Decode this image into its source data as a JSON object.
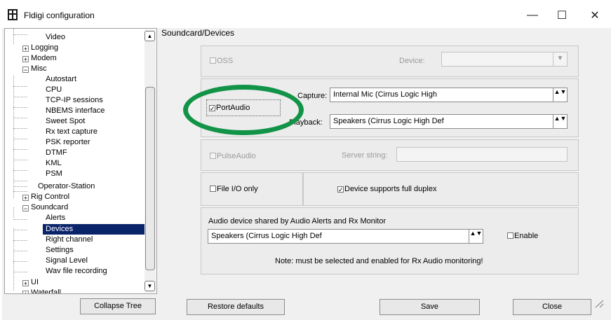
{
  "window": {
    "title": "Fldigi configuration",
    "minimize_glyph": "—",
    "maximize_glyph": "☐",
    "close_glyph": "✕"
  },
  "section_title": "Soundcard/Devices",
  "tree": {
    "items": [
      {
        "label": "Video",
        "level": 1
      },
      {
        "label": "Logging",
        "level": 0,
        "toggle": "+"
      },
      {
        "label": "Modem",
        "level": 0,
        "toggle": "+"
      },
      {
        "label": "Misc",
        "level": 0,
        "toggle": "−"
      },
      {
        "label": "Autostart",
        "level": 1
      },
      {
        "label": "CPU",
        "level": 1
      },
      {
        "label": "TCP-IP sessions",
        "level": 1
      },
      {
        "label": "NBEMS interface",
        "level": 1
      },
      {
        "label": "Sweet Spot",
        "level": 1
      },
      {
        "label": "Rx text capture",
        "level": 1
      },
      {
        "label": "PSK reporter",
        "level": 1
      },
      {
        "label": "DTMF",
        "level": 1
      },
      {
        "label": "KML",
        "level": 1
      },
      {
        "label": "PSM",
        "level": 1
      },
      {
        "label": "Operator-Station",
        "level": 0
      },
      {
        "label": "Rig Control",
        "level": 0,
        "toggle": "+"
      },
      {
        "label": "Soundcard",
        "level": 0,
        "toggle": "−"
      },
      {
        "label": "Alerts",
        "level": 1
      },
      {
        "label": "Devices",
        "level": 1,
        "selected": true
      },
      {
        "label": "Right channel",
        "level": 1
      },
      {
        "label": "Settings",
        "level": 1
      },
      {
        "label": "Signal Level",
        "level": 1
      },
      {
        "label": "Wav file recording",
        "level": 1
      },
      {
        "label": "UI",
        "level": 0,
        "toggle": "+"
      },
      {
        "label": "Waterfall",
        "level": 0,
        "toggle": "+"
      }
    ],
    "scroll_up_glyph": "▲",
    "scroll_down_glyph": "▼"
  },
  "oss": {
    "label": "OSS",
    "checked": false,
    "device_label": "Device:",
    "device_value": ""
  },
  "portaudio": {
    "label": "PortAudio",
    "checked": true,
    "check_glyph": "✓",
    "capture_label": "Capture:",
    "capture_value": "Internal Mic (Cirrus Logic High",
    "playback_label": "Playback:",
    "playback_value": "Speakers (Cirrus Logic High Def"
  },
  "pulseaudio": {
    "label": "PulseAudio",
    "checked": false,
    "server_label": "Server string:",
    "server_value": ""
  },
  "file_io": {
    "label": "File I/O only",
    "checked": false
  },
  "full_duplex": {
    "label": "Device supports full duplex",
    "checked": true,
    "check_glyph": "✓"
  },
  "shared": {
    "title": "Audio device shared by Audio Alerts and Rx Monitor",
    "device_value": "Speakers (Cirrus Logic High Def",
    "enable_label": "Enable",
    "enable_checked": false,
    "note": "Note: must be selected and enabled for Rx Audio monitoring!"
  },
  "combo_arrows": "▲▼",
  "combo_dropdown_glyph": "▼",
  "buttons": {
    "collapse_tree": "Collapse Tree",
    "restore_defaults": "Restore defaults",
    "save": "Save",
    "close": "Close"
  },
  "colors": {
    "selection": "#0a246a",
    "annotation_circle": "#119348"
  }
}
